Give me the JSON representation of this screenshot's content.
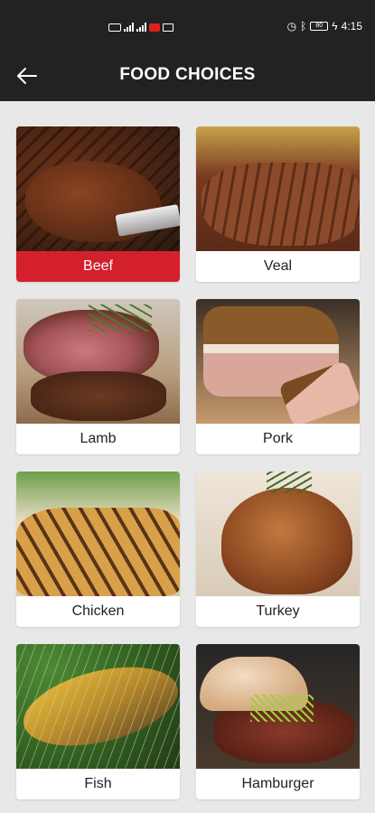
{
  "status_bar": {
    "time": "4:15",
    "left_icons": [
      "sim-card-icon",
      "signal-icon",
      "signal-icon",
      "notification-icon",
      "mail-icon"
    ],
    "right_icons": [
      "alarm-icon",
      "bluetooth-icon",
      "battery-icon",
      "charging-icon"
    ],
    "battery_level": "80"
  },
  "app_bar": {
    "title": "FOOD CHOICES",
    "back_icon": "arrow-left-icon"
  },
  "colors": {
    "bar_background": "#222222",
    "page_background": "#e8e8e8",
    "selected_accent": "#d4202d"
  },
  "food_choices": [
    {
      "label": "Beef",
      "selected": true
    },
    {
      "label": "Veal",
      "selected": false
    },
    {
      "label": "Lamb",
      "selected": false
    },
    {
      "label": "Pork",
      "selected": false
    },
    {
      "label": "Chicken",
      "selected": false
    },
    {
      "label": "Turkey",
      "selected": false
    },
    {
      "label": "Fish",
      "selected": false
    },
    {
      "label": "Hamburger",
      "selected": false
    }
  ]
}
